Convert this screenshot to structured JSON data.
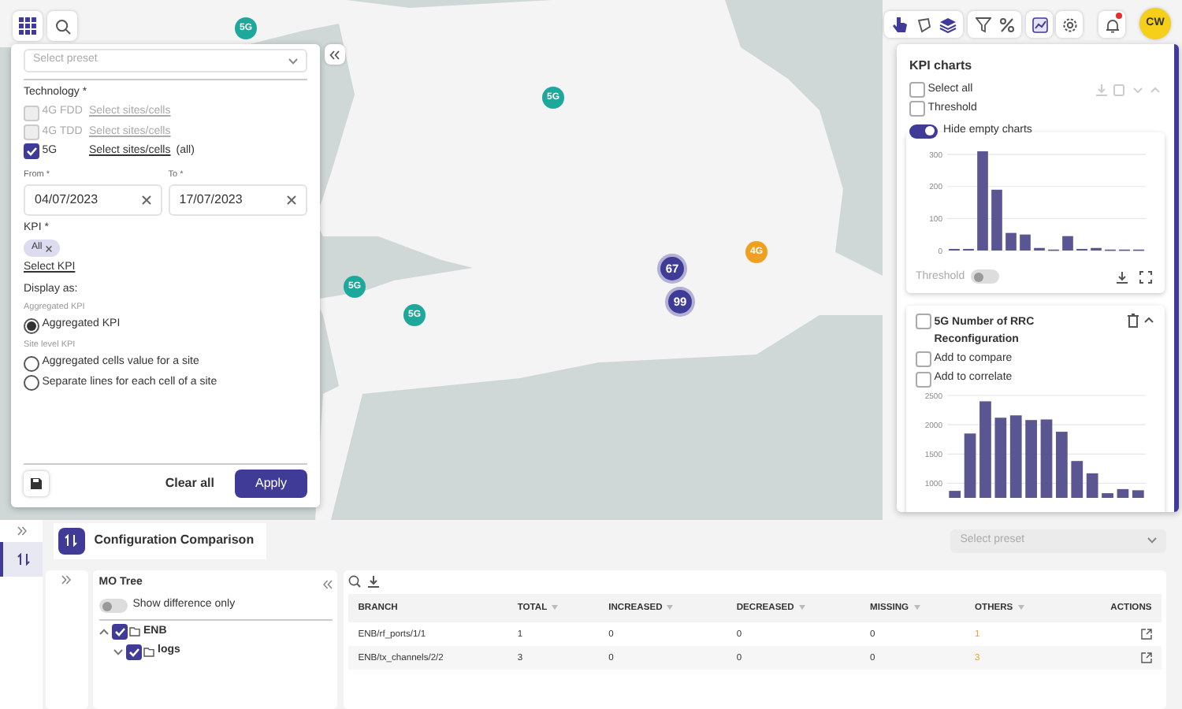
{
  "map": {
    "markers": [
      {
        "label": "5G",
        "color": "#1ea79b"
      },
      {
        "label": "5G",
        "color": "#1ea79b"
      },
      {
        "label": "5G",
        "color": "#1ea79b"
      },
      {
        "label": "5G",
        "color": "#1ea79b"
      },
      {
        "label": "67",
        "color": "#3f3b96"
      },
      {
        "label": "99",
        "color": "#3f3b96"
      },
      {
        "label": "4G",
        "color": "#f0a020"
      }
    ]
  },
  "toolbar": {
    "avatar": "CW",
    "notification": true
  },
  "filter_panel": {
    "preset": {
      "placeholder": "Select preset"
    },
    "technology_label": "Technology *",
    "technologies": [
      {
        "name": "4G FDD",
        "checked": false,
        "disabled": true,
        "link": "Select sites/cells"
      },
      {
        "name": "4G TDD",
        "checked": false,
        "disabled": true,
        "link": "Select sites/cells"
      },
      {
        "name": "5G",
        "checked": true,
        "disabled": false,
        "link": "Select sites/cells",
        "note": "(all)"
      }
    ],
    "from": {
      "label": "From *",
      "value": "04/07/2023"
    },
    "to": {
      "label": "To *",
      "value": "17/07/2023"
    },
    "kpi_label": "KPI *",
    "kpi_chips": [
      "All"
    ],
    "select_kpi": "Select KPI",
    "display_as": "Display as:",
    "radio_groups": [
      {
        "label": "Aggregated KPI",
        "options": [
          {
            "label": "Aggregated KPI",
            "selected": true
          }
        ]
      },
      {
        "label": "Site level KPI",
        "options": [
          {
            "label": "Aggregated cells value for a site",
            "selected": false
          },
          {
            "label": "Separate lines for each cell of a site",
            "selected": false
          }
        ]
      }
    ],
    "clear_button": "Clear all",
    "apply_button": "Apply"
  },
  "kpi_panel": {
    "title": "KPI charts",
    "select_all": {
      "label": "Select all",
      "checked": false
    },
    "threshold": {
      "label": "Threshold",
      "checked": false
    },
    "hide_empty": {
      "label": "Hide empty charts",
      "on": true
    },
    "cards": [
      {
        "kind": "plain",
        "threshold_label": "Threshold",
        "threshold_on": false,
        "chart_data": {
          "type": "bar",
          "values": [
            5,
            5,
            310,
            190,
            55,
            50,
            8,
            3,
            45,
            5,
            8,
            3,
            3,
            3
          ],
          "ylim": [
            0,
            320
          ],
          "yticks": [
            0,
            100,
            200,
            300
          ],
          "grid": true
        }
      },
      {
        "kind": "titled",
        "title": "5G Number of RRC Reconfiguration",
        "checked": false,
        "options": [
          {
            "label": "Add to compare",
            "checked": false
          },
          {
            "label": "Add to correlate",
            "checked": false
          }
        ],
        "chart_data": {
          "type": "bar",
          "values": [
            870,
            1850,
            2400,
            2120,
            2160,
            2080,
            2090,
            1880,
            1380,
            1170,
            830,
            900,
            880
          ],
          "ylim": [
            750,
            2500
          ],
          "yticks": [
            1000,
            1500,
            2000,
            2500
          ],
          "grid": true
        }
      }
    ]
  },
  "bottom": {
    "title": "Configuration Comparison",
    "preset": {
      "placeholder": "Select preset"
    },
    "mo_tree": {
      "title": "MO Tree",
      "diff_toggle": {
        "label": "Show difference only",
        "on": false
      },
      "tree": [
        {
          "label": "ENB",
          "checked": true,
          "expanded": true,
          "children": [
            {
              "label": "logs",
              "checked": true,
              "expanded": false
            }
          ]
        }
      ]
    },
    "table": {
      "columns": [
        {
          "label": "BRANCH",
          "sortable": false
        },
        {
          "label": "TOTAL",
          "sortable": true
        },
        {
          "label": "INCREASED",
          "sortable": true
        },
        {
          "label": "DECREASED",
          "sortable": true
        },
        {
          "label": "MISSING",
          "sortable": true
        },
        {
          "label": "OTHERS",
          "sortable": true
        },
        {
          "label": "ACTIONS",
          "sortable": false
        }
      ],
      "rows": [
        [
          "ENB/rf_ports/1/1",
          "1",
          "0",
          "0",
          "0",
          "1"
        ],
        [
          "ENB/tx_channels/2/2",
          "3",
          "0",
          "0",
          "0",
          "3"
        ]
      ]
    }
  }
}
